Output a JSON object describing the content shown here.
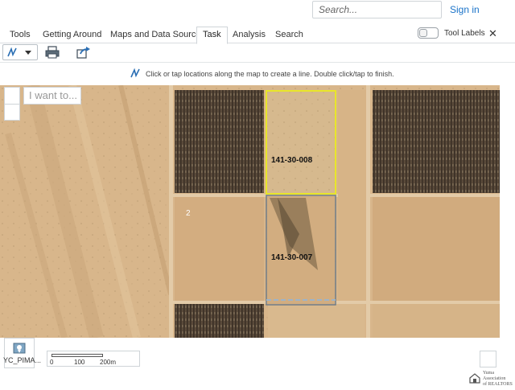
{
  "header": {
    "search_placeholder": "Search...",
    "sign_in": "Sign in"
  },
  "tabs": [
    {
      "label": "Tools",
      "active": false
    },
    {
      "label": "Getting Around",
      "active": false
    },
    {
      "label": "Maps and Data Sources",
      "active": false
    },
    {
      "label": "Task",
      "active": true
    },
    {
      "label": "Analysis",
      "active": false
    },
    {
      "label": "Search",
      "active": false
    }
  ],
  "tool_labels": {
    "label": "Tool Labels",
    "on": false
  },
  "close_icon": "close-icon",
  "toolbar": {
    "icons": [
      "polyline-icon",
      "chevron-down-icon",
      "print-icon",
      "share-icon"
    ]
  },
  "hint": {
    "icon": "polyline-icon",
    "text": "Click or tap locations along the map to create a line. Double click/tap to finish."
  },
  "map": {
    "i_want_to": "I want to...",
    "parcels": [
      {
        "id": "141-30-008",
        "highlighted": true
      },
      {
        "id": "141-30-007",
        "highlighted": false
      }
    ],
    "section_number": "2"
  },
  "footer": {
    "layer_label": "YC_PIMA...",
    "scale_ticks": [
      "0",
      "100",
      "200m"
    ],
    "logo_lines": [
      "Yuma",
      "Association",
      "of REALTORS"
    ]
  },
  "colors": {
    "link": "#1a73c9",
    "highlight": "#e8e62a",
    "parcel_outline": "#6f7b86"
  }
}
